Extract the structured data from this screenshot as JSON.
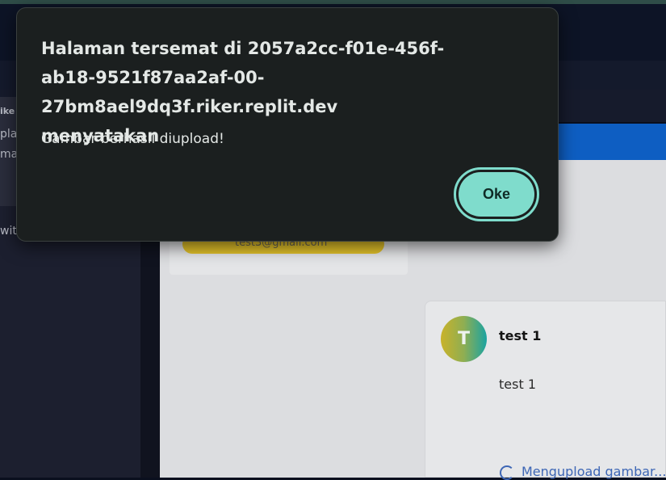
{
  "background": {
    "left_text_lines": [
      "ike",
      "plat",
      "mal",
      "wit"
    ],
    "email_chip": "test3@gmail.com",
    "post": {
      "avatar_letter": "T",
      "author": "test 1",
      "body": "test 1",
      "status": "Mengupload gambar..."
    }
  },
  "dialog": {
    "title": "Halaman tersemat di 2057a2cc-f01e-456f-ab18-9521f87aa2af-00-27bm8ael9dq3f.riker.replit.dev menyatakan",
    "title_lines": [
      "Halaman tersemat di 2057a2cc-f01e-456f-",
      "ab18-9521f87aa2af-00-27bm8ael9dq3f.riker.replit.dev",
      "menyatakan"
    ],
    "message": "Gambar berhasil diupload!",
    "ok_label": "Oke"
  },
  "colors": {
    "dialog_bg": "#1b1f1f",
    "button_accent": "#7fdccc",
    "link_blue": "#3d66b5",
    "chip_yellow": "#e3c22a"
  }
}
